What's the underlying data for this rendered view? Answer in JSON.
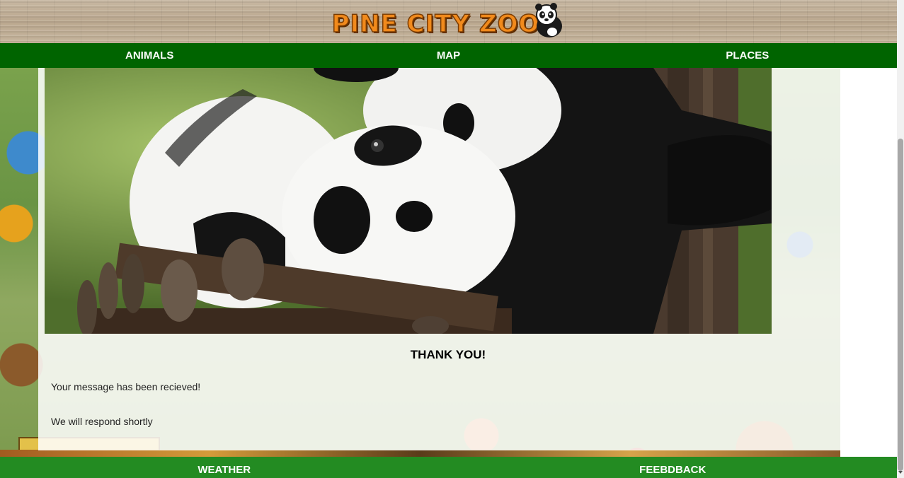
{
  "header": {
    "logo_text": "PINE CITY ZOO",
    "logo_icon": "panda-icon"
  },
  "topnav": {
    "items": [
      {
        "label": "ANIMALS"
      },
      {
        "label": "MAP"
      },
      {
        "label": "PLACES"
      }
    ]
  },
  "main": {
    "hero_image": "panda-photo",
    "title": "THANK YOU!",
    "message_1": "Your message has been recieved!",
    "message_2": "We will respond shortly"
  },
  "footnav": {
    "items": [
      {
        "label": "WEATHER"
      },
      {
        "label": "FEEBDBACK"
      }
    ]
  },
  "colors": {
    "topnav_bg": "#006400",
    "footnav_bg": "#238b22",
    "logo_orange": "#f18a1c"
  }
}
